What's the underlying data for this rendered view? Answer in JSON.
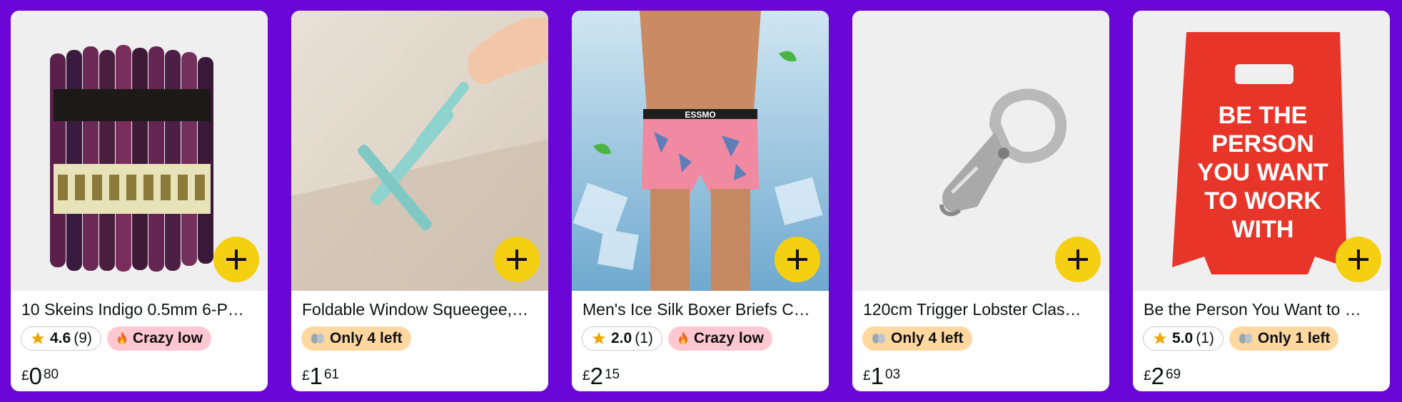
{
  "products": [
    {
      "title": "10 Skeins Indigo 0.5mm 6-P…",
      "rating": "4.6",
      "reviews": "(9)",
      "badge": "Crazy low",
      "badge_icon": "fire-icon",
      "currency": "£",
      "price_whole": "0",
      "price_fraction": "80"
    },
    {
      "title": "Foldable Window Squeegee,…",
      "badge": "Only 4 left",
      "badge_icon": "stock-icon",
      "currency": "£",
      "price_whole": "1",
      "price_fraction": "61"
    },
    {
      "title": "Men's Ice Silk Boxer Briefs C…",
      "rating": "2.0",
      "reviews": "(1)",
      "badge": "Crazy low",
      "badge_icon": "fire-icon",
      "currency": "£",
      "price_whole": "2",
      "price_fraction": "15",
      "brand_text": "ESSMO"
    },
    {
      "title": "120cm Trigger Lobster Clas…",
      "badge": "Only 4 left",
      "badge_icon": "stock-icon",
      "currency": "£",
      "price_whole": "1",
      "price_fraction": "03"
    },
    {
      "title": "Be the Person You Want to …",
      "rating": "5.0",
      "reviews": "(1)",
      "badge": "Only 1 left",
      "badge_icon": "stock-icon",
      "currency": "£",
      "price_whole": "2",
      "price_fraction": "69",
      "sign_text": [
        "BE THE",
        "PERSON",
        "YOU WANT",
        "TO WORK",
        "WITH"
      ]
    }
  ],
  "colors": {
    "background": "#6a06d6",
    "add_button": "#f5cf12",
    "crazy_low_pill": "#ffc8d0",
    "stock_pill": "#ffd7a0",
    "star": "#f0a500"
  }
}
